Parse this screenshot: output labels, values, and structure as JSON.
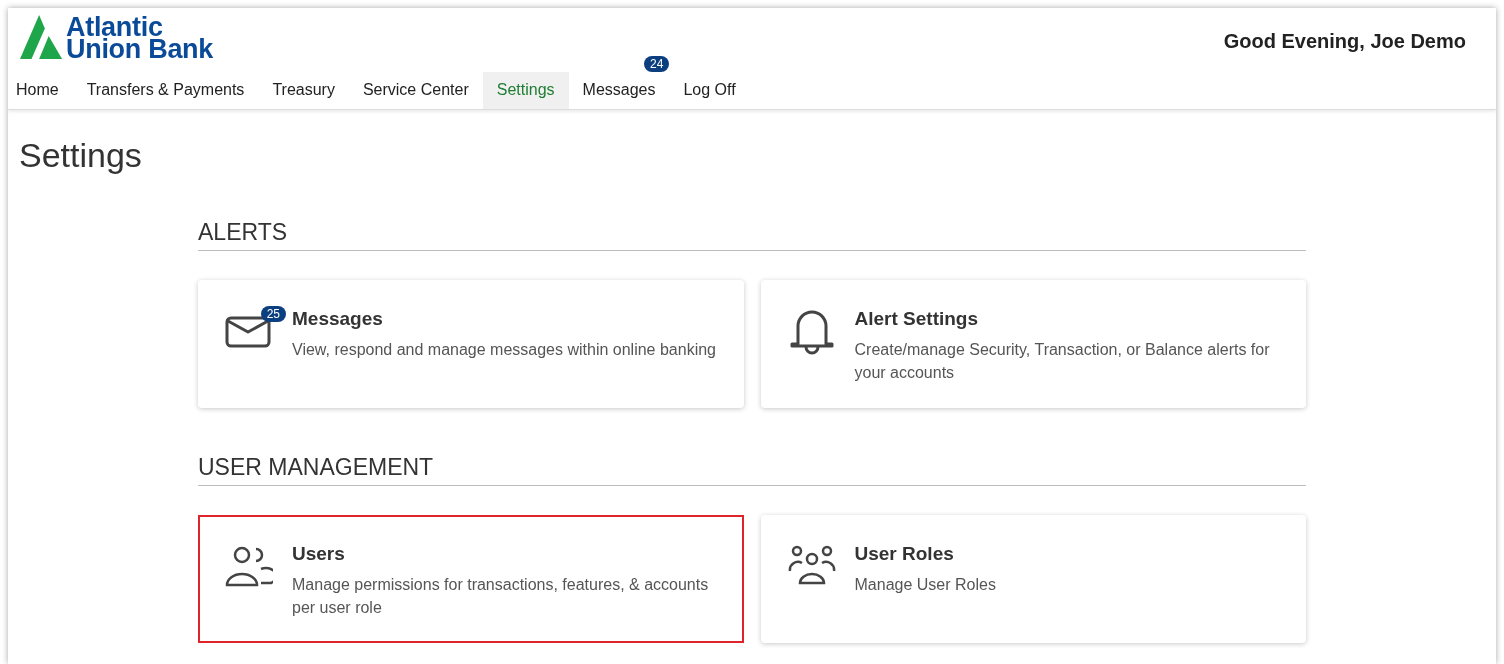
{
  "logo": {
    "line1": "Atlantic",
    "line2": "Union Bank"
  },
  "greeting": "Good Evening, Joe Demo",
  "nav": [
    {
      "label": "Home",
      "selected": false
    },
    {
      "label": "Transfers & Payments",
      "selected": false
    },
    {
      "label": "Treasury",
      "selected": false
    },
    {
      "label": "Service Center",
      "selected": false
    },
    {
      "label": "Settings",
      "selected": true
    },
    {
      "label": "Messages",
      "selected": false,
      "badge": "24"
    },
    {
      "label": "Log Off",
      "selected": false
    }
  ],
  "page_title": "Settings",
  "sections": [
    {
      "heading": "ALERTS",
      "cards": [
        {
          "kind": "envelope",
          "title": "Messages",
          "description": "View, respond and manage messages within online banking",
          "badge": "25",
          "highlighted": false
        },
        {
          "kind": "bell",
          "title": "Alert Settings",
          "description": "Create/manage Security, Transaction, or Balance alerts for your accounts",
          "highlighted": false
        }
      ]
    },
    {
      "heading": "USER MANAGEMENT",
      "cards": [
        {
          "kind": "users",
          "title": "Users",
          "description": "Manage permissions for transactions, features, & accounts per user role",
          "highlighted": true
        },
        {
          "kind": "group",
          "title": "User Roles",
          "description": "Manage User Roles",
          "highlighted": false
        }
      ]
    }
  ]
}
